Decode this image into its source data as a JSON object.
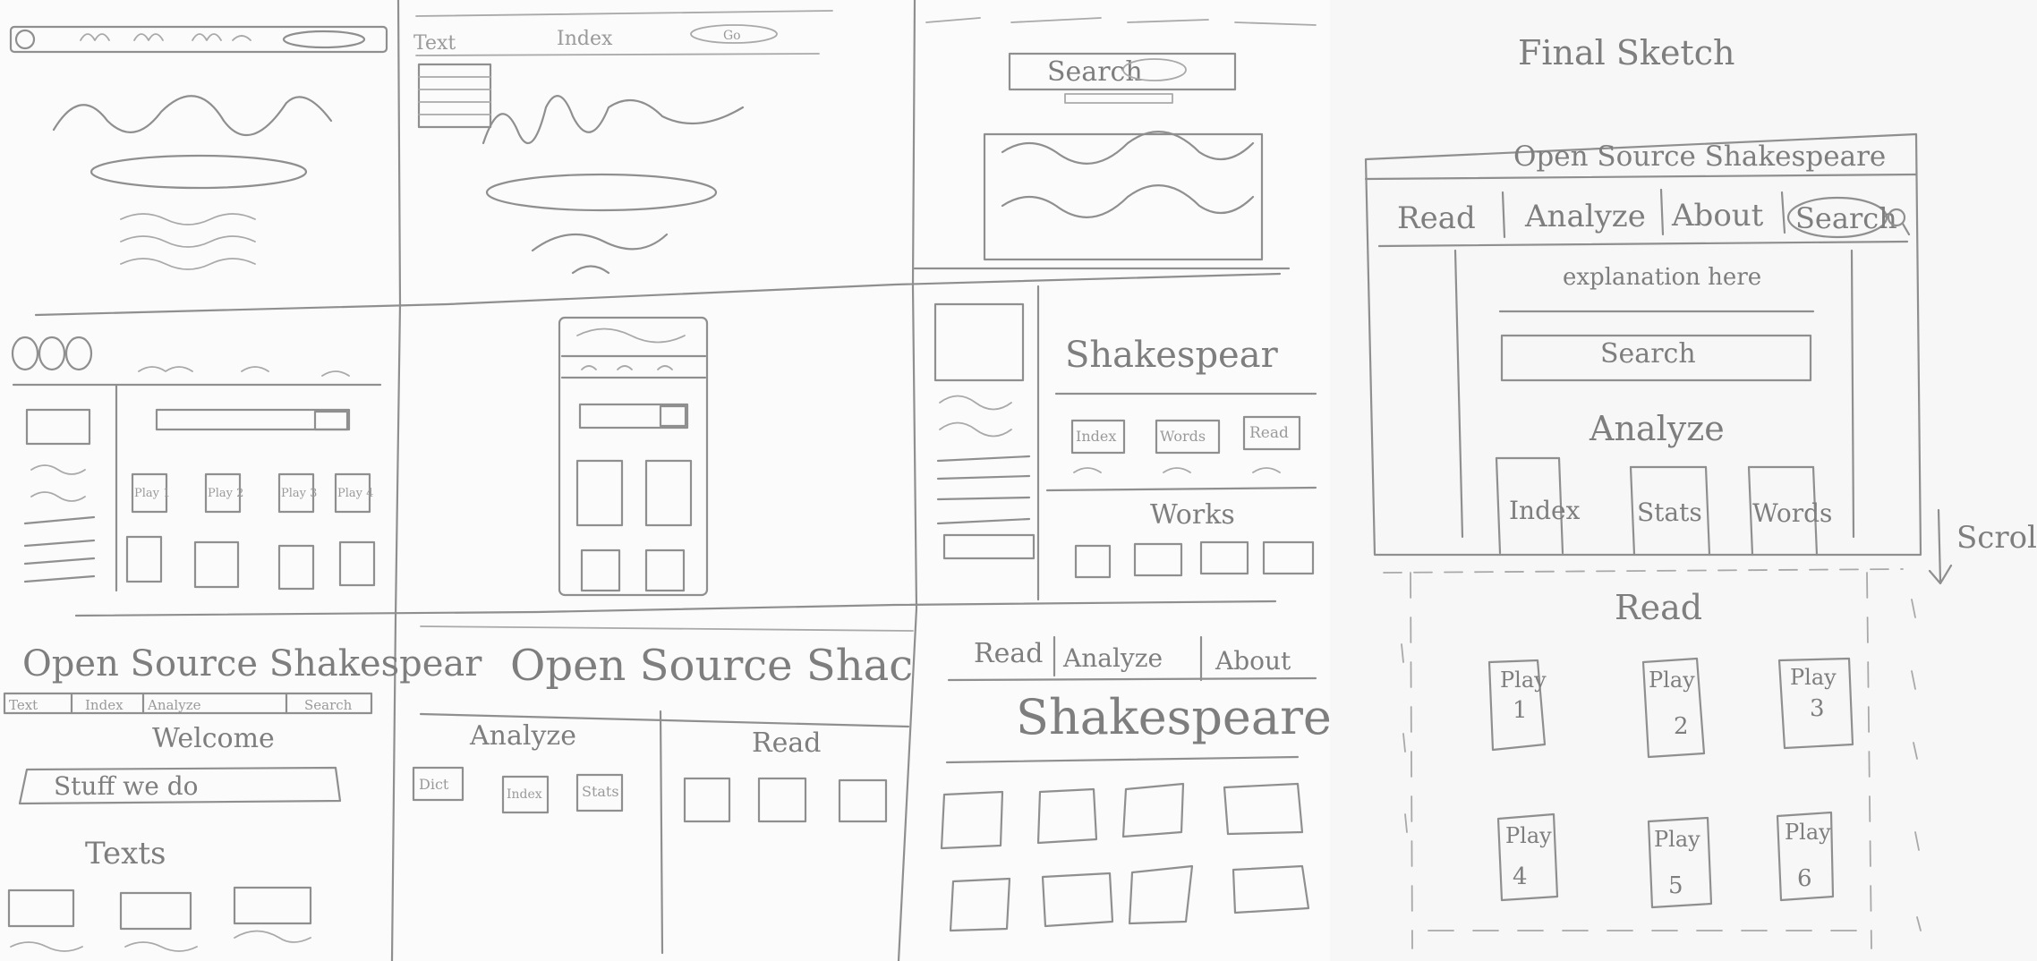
{
  "sketches": {
    "top_middle": {
      "text_label": "Text",
      "index_label": "Index",
      "button_label": "Go"
    },
    "top_right": {
      "search_label": "Search"
    },
    "mid_left": {
      "plays": [
        "Play 1",
        "Play 2",
        "Play 3",
        "Play 4"
      ]
    },
    "mid_right": {
      "title": "Shakespear",
      "index_label": "Index",
      "words_label": "Words",
      "read_label": "Read",
      "works_label": "Works"
    },
    "bottom_left": {
      "title": "Open Source Shakespear",
      "nav": [
        "Text",
        "Index",
        "Analyze",
        "Search"
      ],
      "welcome": "Welcome",
      "stuff": "Stuff we do",
      "texts_label": "Texts"
    },
    "bottom_middle": {
      "title": "Open Source Shac",
      "analyze": "Analyze",
      "read": "Read",
      "buttons": [
        "Dict",
        "Index",
        "Stats"
      ]
    },
    "bottom_right": {
      "nav": [
        "Read",
        "Analyze",
        "About"
      ],
      "title": "Shakespeare"
    }
  },
  "final": {
    "heading": "Final Sketch",
    "site_title": "Open Source Shakespeare",
    "nav": [
      "Read",
      "Analyze",
      "About",
      "Search"
    ],
    "explanation": "explanation here",
    "search_label": "Search",
    "analyze_heading": "Analyze",
    "analyze_buttons": [
      "Index",
      "Stats",
      "Words"
    ],
    "scroll_label": "Scroll",
    "read_heading": "Read",
    "plays": [
      {
        "line1": "Play",
        "line2": "1"
      },
      {
        "line1": "Play",
        "line2": "2"
      },
      {
        "line1": "Play",
        "line2": "3"
      },
      {
        "line1": "Play",
        "line2": "4"
      },
      {
        "line1": "Play",
        "line2": "5"
      },
      {
        "line1": "Play",
        "line2": "6"
      }
    ]
  }
}
